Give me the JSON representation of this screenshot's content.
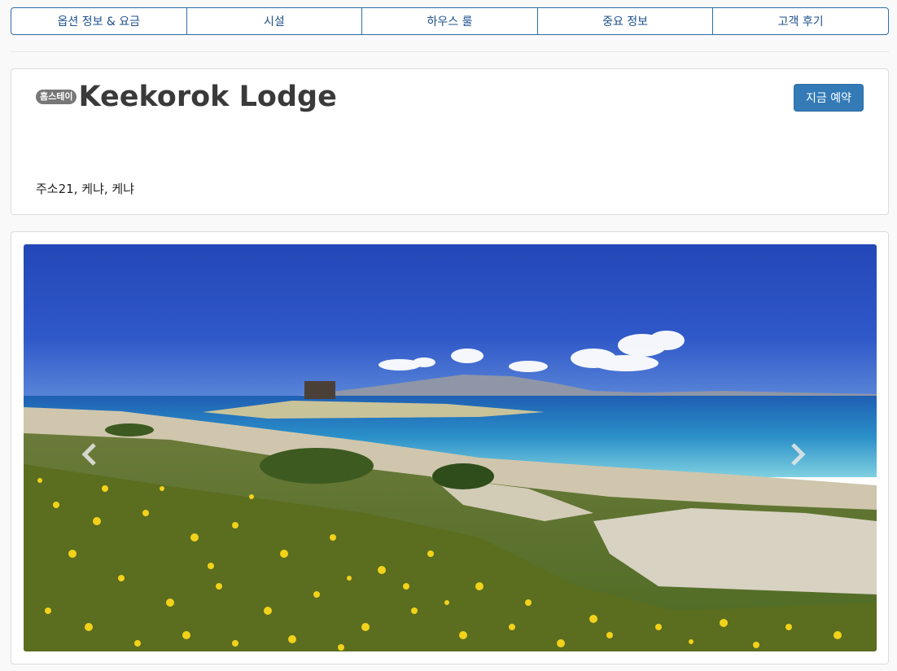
{
  "tabs": [
    {
      "label": "옵션 정보 & 요금"
    },
    {
      "label": "시설"
    },
    {
      "label": "하우스 룰"
    },
    {
      "label": "중요 정보"
    },
    {
      "label": "고객 후기"
    }
  ],
  "property": {
    "badge": "홈스테이",
    "name": "Keekorok Lodge",
    "address": "주소21, 케냐, 케냐",
    "book_button": "지금 예약"
  },
  "gallery": {
    "prev_icon": "chevron-left-icon",
    "next_icon": "chevron-right-icon"
  },
  "colors": {
    "accent": "#337ab7",
    "tab_border": "#2f6ea8",
    "badge_bg": "#777777"
  }
}
